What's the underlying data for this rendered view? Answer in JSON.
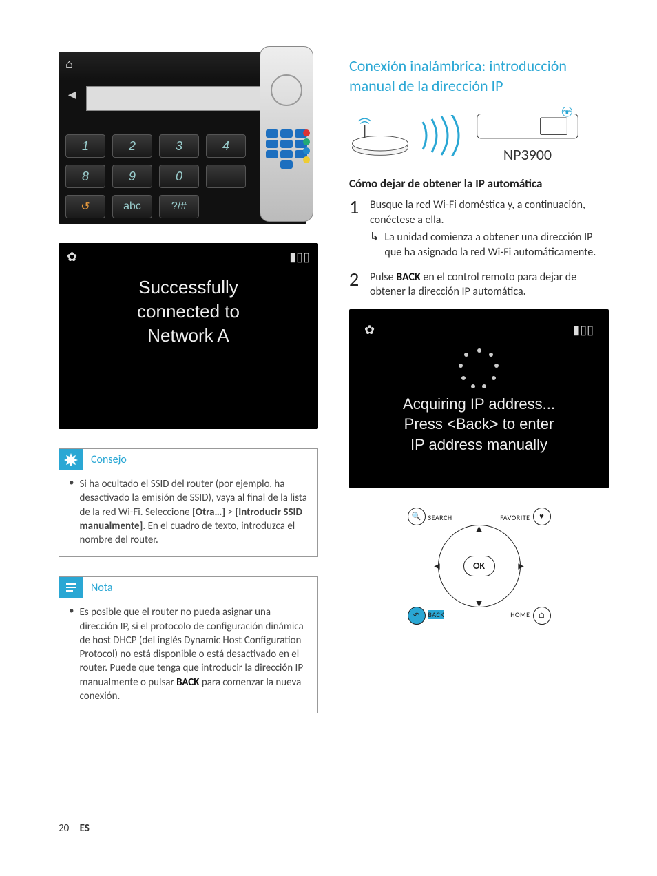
{
  "screen1": {
    "success_line1": "Successfully",
    "success_line2": "connected to",
    "success_line3": "Network A"
  },
  "keypad": {
    "keys_row1": [
      "1",
      "2",
      "3",
      "4"
    ],
    "keys_row2": [
      "8",
      "9",
      "0",
      ""
    ],
    "bottom": [
      "↺",
      "abc",
      "?/#"
    ]
  },
  "tip": {
    "title": "Consejo",
    "body_pre": "Si ha ocultado el SSID del router (por ejemplo, ha desactivado la emisión de SSID), vaya al final de la lista de la red Wi-Fi. Seleccione ",
    "menu1": "[Otra…]",
    "gt": " > ",
    "menu2": "[Introducir SSID manualmente]",
    "body_post": ". En el cuadro de texto, introduzca el nombre del router."
  },
  "note": {
    "title": "Nota",
    "body_pre": "Es posible que el router no pueda asignar una dirección IP, si el protocolo de configuración dinámica de host DHCP (del inglés Dynamic Host Configuration Protocol) no está disponible o está desactivado en el router. Puede que tenga que introducir la dirección IP manualmente o pulsar ",
    "back": "BACK",
    "body_post": " para comenzar la nueva conexión."
  },
  "section": {
    "title": "Conexión inalámbrica: introducción manual de la dirección IP",
    "model": "NP3900",
    "subheading": "Cómo dejar de obtener la IP automática"
  },
  "steps": {
    "s1_num": "1",
    "s1_text": "Busque la red Wi-Fi doméstica y, a continuación, conéctese a ella.",
    "s1_sub": "La unidad comienza a obtener una dirección IP que ha asignado la red Wi-Fi automáticamente.",
    "s2_num": "2",
    "s2_pre": "Pulse ",
    "s2_back": "BACK",
    "s2_post": " en el control remoto para dejar de obtener la dirección IP automática."
  },
  "screen2": {
    "line1": "Acquiring IP address...",
    "line2": "Press <Back> to enter",
    "line3": "IP address manually"
  },
  "navpad": {
    "ok": "OK",
    "search": "SEARCH",
    "favorite": "FAVORITE",
    "back": "BACK",
    "home": "HOME"
  },
  "footer": {
    "page": "20",
    "lang": "ES"
  }
}
